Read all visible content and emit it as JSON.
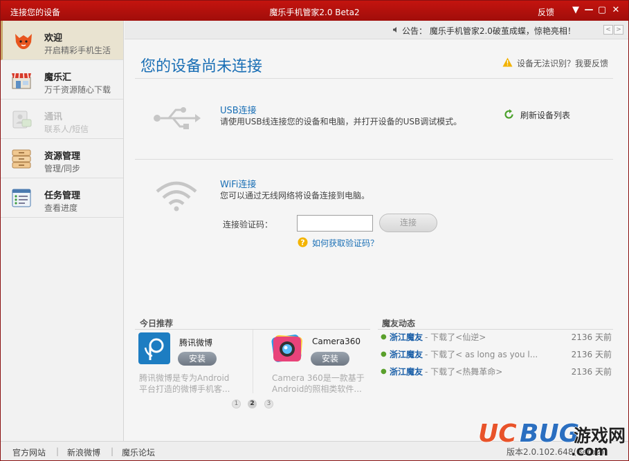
{
  "titlebar": {
    "left_title": "连接您的设备",
    "center_title": "魔乐手机管家2.0 Beta2",
    "feedback": "反馈"
  },
  "sidebar": {
    "items": [
      {
        "title": "欢迎",
        "sub": "开启精彩手机生活",
        "icon": "fox-icon"
      },
      {
        "title": "魔乐汇",
        "sub": "万千资源随心下载",
        "icon": "store-icon"
      },
      {
        "title": "通讯",
        "sub": "联系人/短信",
        "icon": "contacts-icon"
      },
      {
        "title": "资源管理",
        "sub": "管理/同步",
        "icon": "folder-icon"
      },
      {
        "title": "任务管理",
        "sub": "查看进度",
        "icon": "task-list-icon"
      }
    ]
  },
  "notice": {
    "text": "公告：  魔乐手机管家2.0破茧成蝶，惊艳亮相！"
  },
  "main": {
    "title": "您的设备尚未连接",
    "warn": "设备无法识别？我要反馈",
    "usb": {
      "title": "USB连接",
      "desc": "请使用USB线连接您的设备和电脑，并打开设备的USB调试模式。",
      "refresh": "刷新设备列表"
    },
    "wifi": {
      "title": "WiFi连接",
      "desc": "您可以通过无线网络将设备连接到电脑。",
      "code_label": "连接验证码：",
      "code_value": "",
      "connect": "连接",
      "howto": "如何获取验证码？"
    }
  },
  "recommend": {
    "title": "今日推荐",
    "apps": [
      {
        "name": "腾讯微博",
        "install": "安装",
        "desc1": "腾讯微博是专为Android",
        "desc2": "平台打造的微博手机客..."
      },
      {
        "name": "Camera360",
        "install": "安装",
        "desc1": "Camera 360是一款基于",
        "desc2": "Android的照相类软件..."
      }
    ],
    "pages": [
      "1",
      "2",
      "3"
    ]
  },
  "activity": {
    "title": "魔友动态",
    "items": [
      {
        "who": "浙江魔友",
        "what": "- 下载了<仙逆>",
        "when": "2136 天前"
      },
      {
        "who": "浙江魔友",
        "what": "- 下载了< as long as you l...",
        "when": "2136 天前"
      },
      {
        "who": "浙江魔友",
        "what": "- 下载了<热舞革命>",
        "when": "2136 天前"
      }
    ]
  },
  "statusbar": {
    "links": [
      "官方网站",
      "新浪微博",
      "魔乐论坛"
    ],
    "version": "版本2.0.102.648(Beta2)"
  },
  "watermark": {
    "text1": "UCBUG",
    "text2": "游戏网",
    "text3": ".com"
  },
  "colors": {
    "title_bar": "#b3100c",
    "accent_blue": "#1a6fb5",
    "activity_green": "#5aa02c"
  }
}
